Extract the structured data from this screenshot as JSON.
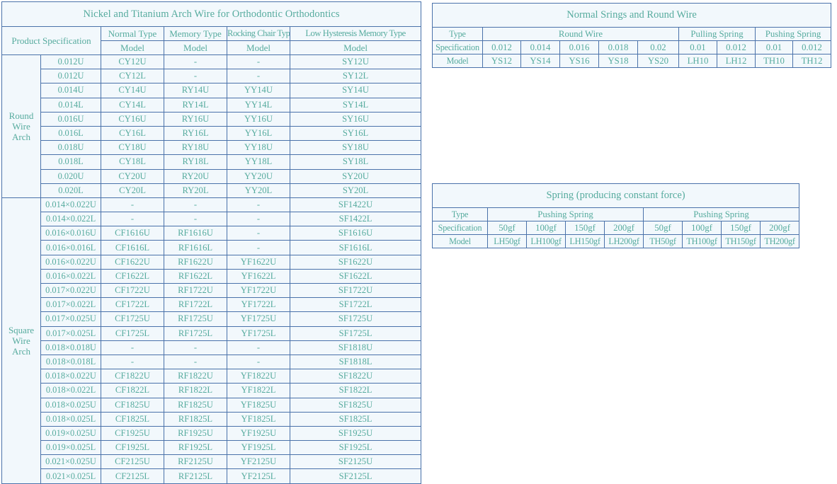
{
  "colors": {
    "border": "#4a72aa",
    "text": "#56ab9e",
    "cell_background": "#f2f8fc",
    "page_background": "#ffffff"
  },
  "arch_wire_table": {
    "title": "Nickel and Titanium Arch Wire for Orthodontic Orthodontics",
    "spec_header": "Product Specification",
    "type_headers": [
      "Normal Type",
      "Memory Type",
      "Rocking Chair Type",
      "Low Hysteresis Memory Type"
    ],
    "sub_header": "Model",
    "groups": [
      {
        "label": "Round Wire Arch",
        "rows": [
          {
            "spec": "0.012U",
            "models": [
              "CY12U",
              "-",
              "-",
              "SY12U"
            ]
          },
          {
            "spec": "0.012U",
            "models": [
              "CY12L",
              "-",
              "-",
              "SY12L"
            ]
          },
          {
            "spec": "0.014U",
            "models": [
              "CY14U",
              "RY14U",
              "YY14U",
              "SY14U"
            ]
          },
          {
            "spec": "0.014L",
            "models": [
              "CY14L",
              "RY14L",
              "YY14L",
              "SY14L"
            ]
          },
          {
            "spec": "0.016U",
            "models": [
              "CY16U",
              "RY16U",
              "YY16U",
              "SY16U"
            ]
          },
          {
            "spec": "0.016L",
            "models": [
              "CY16L",
              "RY16L",
              "YY16L",
              "SY16L"
            ]
          },
          {
            "spec": "0.018U",
            "models": [
              "CY18U",
              "RY18U",
              "YY18U",
              "SY18U"
            ]
          },
          {
            "spec": "0.018L",
            "models": [
              "CY18L",
              "RY18L",
              "YY18L",
              "SY18L"
            ]
          },
          {
            "spec": "0.020U",
            "models": [
              "CY20U",
              "RY20U",
              "YY20U",
              "SY20U"
            ]
          },
          {
            "spec": "0.020L",
            "models": [
              "CY20L",
              "RY20L",
              "YY20L",
              "SY20L"
            ]
          }
        ]
      },
      {
        "label": "Square Wire Arch",
        "rows": [
          {
            "spec": "0.014×0.022U",
            "models": [
              "-",
              "-",
              "-",
              "SF1422U"
            ]
          },
          {
            "spec": "0.014×0.022L",
            "models": [
              "-",
              "-",
              "-",
              "SF1422L"
            ]
          },
          {
            "spec": "0.016×0.016U",
            "models": [
              "CF1616U",
              "RF1616U",
              "-",
              "SF1616U"
            ]
          },
          {
            "spec": "0.016×0.016L",
            "models": [
              "CF1616L",
              "RF1616L",
              "-",
              "SF1616L"
            ]
          },
          {
            "spec": "0.016×0.022U",
            "models": [
              "CF1622U",
              "RF1622U",
              "YF1622U",
              "SF1622U"
            ]
          },
          {
            "spec": "0.016×0.022L",
            "models": [
              "CF1622L",
              "RF1622L",
              "YF1622L",
              "SF1622L"
            ]
          },
          {
            "spec": "0.017×0.022U",
            "models": [
              "CF1722U",
              "RF1722U",
              "YF1722U",
              "SF1722U"
            ]
          },
          {
            "spec": "0.017×0.022L",
            "models": [
              "CF1722L",
              "RF1722L",
              "YF1722L",
              "SF1722L"
            ]
          },
          {
            "spec": "0.017×0.025U",
            "models": [
              "CF1725U",
              "RF1725U",
              "YF1725U",
              "SF1725U"
            ]
          },
          {
            "spec": "0.017×0.025L",
            "models": [
              "CF1725L",
              "RF1725L",
              "YF1725L",
              "SF1725L"
            ]
          },
          {
            "spec": "0.018×0.018U",
            "models": [
              "-",
              "-",
              "-",
              "SF1818U"
            ]
          },
          {
            "spec": "0.018×0.018L",
            "models": [
              "-",
              "-",
              "-",
              "SF1818L"
            ]
          },
          {
            "spec": "0.018×0.022U",
            "models": [
              "CF1822U",
              "RF1822U",
              "YF1822U",
              "SF1822U"
            ]
          },
          {
            "spec": "0.018×0.022L",
            "models": [
              "CF1822L",
              "RF1822L",
              "YF1822L",
              "SF1822L"
            ]
          },
          {
            "spec": "0.018×0.025U",
            "models": [
              "CF1825U",
              "RF1825U",
              "YF1825U",
              "SF1825U"
            ]
          },
          {
            "spec": "0.018×0.025L",
            "models": [
              "CF1825L",
              "RF1825L",
              "YF1825L",
              "SF1825L"
            ]
          },
          {
            "spec": "0.019×0.025U",
            "models": [
              "CF1925U",
              "RF1925U",
              "YF1925U",
              "SF1925U"
            ]
          },
          {
            "spec": "0.019×0.025L",
            "models": [
              "CF1925L",
              "RF1925L",
              "YF1925L",
              "SF1925L"
            ]
          },
          {
            "spec": "0.021×0.025U",
            "models": [
              "CF2125U",
              "RF2125U",
              "YF2125U",
              "SF2125U"
            ]
          },
          {
            "spec": "0.021×0.025L",
            "models": [
              "CF2125L",
              "RF2125L",
              "YF2125L",
              "SF2125L"
            ]
          }
        ]
      }
    ]
  },
  "round_wire_table": {
    "title": "Normal Srings and Round Wire",
    "row_labels": [
      "Type",
      "Specification",
      "Model"
    ],
    "groups": [
      {
        "label": "Round Wire",
        "span": 5
      },
      {
        "label": "Pulling Spring",
        "span": 2
      },
      {
        "label": "Pushing Spring",
        "span": 2
      }
    ],
    "specifications": [
      "0.012",
      "0.014",
      "0.016",
      "0.018",
      "0.02",
      "0.01",
      "0.012",
      "0.01",
      "0.012"
    ],
    "models": [
      "YS12",
      "YS14",
      "YS16",
      "YS18",
      "YS20",
      "LH10",
      "LH12",
      "TH10",
      "TH12"
    ]
  },
  "spring_table": {
    "title": "Spring (producing constant force)",
    "row_labels": [
      "Type",
      "Specification",
      "Model"
    ],
    "groups": [
      {
        "label": "Pushing Spring",
        "span": 4
      },
      {
        "label": "Pushing Spring",
        "span": 4
      }
    ],
    "specifications": [
      "50gf",
      "100gf",
      "150gf",
      "200gf",
      "50gf",
      "100gf",
      "150gf",
      "200gf"
    ],
    "models": [
      "LH50gf",
      "LH100gf",
      "LH150gf",
      "LH200gf",
      "TH50gf",
      "TH100gf",
      "TH150gf",
      "TH200gf"
    ]
  }
}
